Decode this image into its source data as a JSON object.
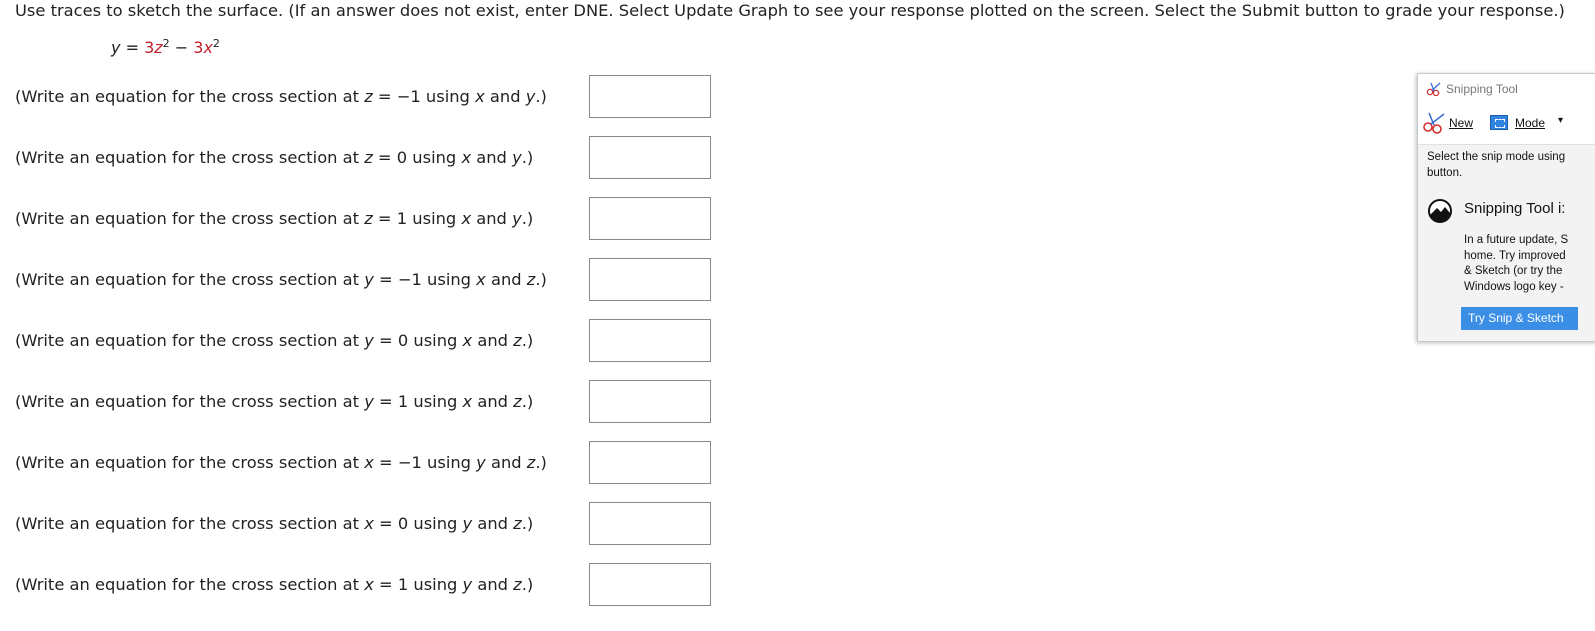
{
  "instructions": "Use traces to sketch the surface. (If an answer does not exist, enter DNE. Select Update Graph to see your response plotted on the screen. Select the Submit button to grade your response.)",
  "surface": {
    "lhs": "y",
    "eq": "=",
    "coef1": "3",
    "var1": "z",
    "exp1": "2",
    "op": "−",
    "coef2": "3",
    "var2": "x",
    "exp2": "2"
  },
  "questions": [
    {
      "pre": "(Write an equation for the cross section at ",
      "var": "z",
      "eq": " = −1 using ",
      "a": "x",
      "mid": " and ",
      "b": "y",
      "post": ".)",
      "answer": ""
    },
    {
      "pre": "(Write an equation for the cross section at ",
      "var": "z",
      "eq": " = 0 using ",
      "a": "x",
      "mid": " and ",
      "b": "y",
      "post": ".)",
      "answer": ""
    },
    {
      "pre": "(Write an equation for the cross section at ",
      "var": "z",
      "eq": " = 1 using ",
      "a": "x",
      "mid": " and ",
      "b": "y",
      "post": ".)",
      "answer": ""
    },
    {
      "pre": "(Write an equation for the cross section at ",
      "var": "y",
      "eq": " = −1 using ",
      "a": "x",
      "mid": " and ",
      "b": "z",
      "post": ".)",
      "answer": ""
    },
    {
      "pre": "(Write an equation for the cross section at ",
      "var": "y",
      "eq": " = 0 using ",
      "a": "x",
      "mid": " and ",
      "b": "z",
      "post": ".)",
      "answer": ""
    },
    {
      "pre": "(Write an equation for the cross section at ",
      "var": "y",
      "eq": " = 1 using ",
      "a": "x",
      "mid": " and ",
      "b": "z",
      "post": ".)",
      "answer": ""
    },
    {
      "pre": "(Write an equation for the cross section at ",
      "var": "x",
      "eq": " = −1 using ",
      "a": "y",
      "mid": " and ",
      "b": "z",
      "post": ".)",
      "answer": ""
    },
    {
      "pre": "(Write an equation for the cross section at ",
      "var": "x",
      "eq": " = 0 using ",
      "a": "y",
      "mid": " and ",
      "b": "z",
      "post": ".)",
      "answer": ""
    },
    {
      "pre": "(Write an equation for the cross section at ",
      "var": "x",
      "eq": " = 1 using ",
      "a": "y",
      "mid": " and ",
      "b": "z",
      "post": ".)",
      "answer": ""
    }
  ],
  "snipping_tool": {
    "title": "Snipping Tool",
    "new_label": "New",
    "mode_label": "Mode",
    "mode_caret": "▾",
    "hint_line1": "Select the snip mode using",
    "hint_line2": "button.",
    "promo_title": "Snipping Tool i:",
    "promo_lines": [
      "In a future update, S",
      "home. Try improved",
      "& Sketch (or try the",
      "Windows logo key -"
    ],
    "try_label": "Try Snip & Sketch",
    "icons": {
      "title": "scissors-icon",
      "new": "scissors-icon",
      "mode": "rectangle-snip-icon",
      "promo": "snip-sketch-logo-icon"
    },
    "colors": {
      "button": "#3a8ee6",
      "mode_icon": "#2f84e0"
    }
  },
  "colors": {
    "text": "#222222",
    "formula_coef": "#c0202a",
    "input_border": "#888888"
  }
}
